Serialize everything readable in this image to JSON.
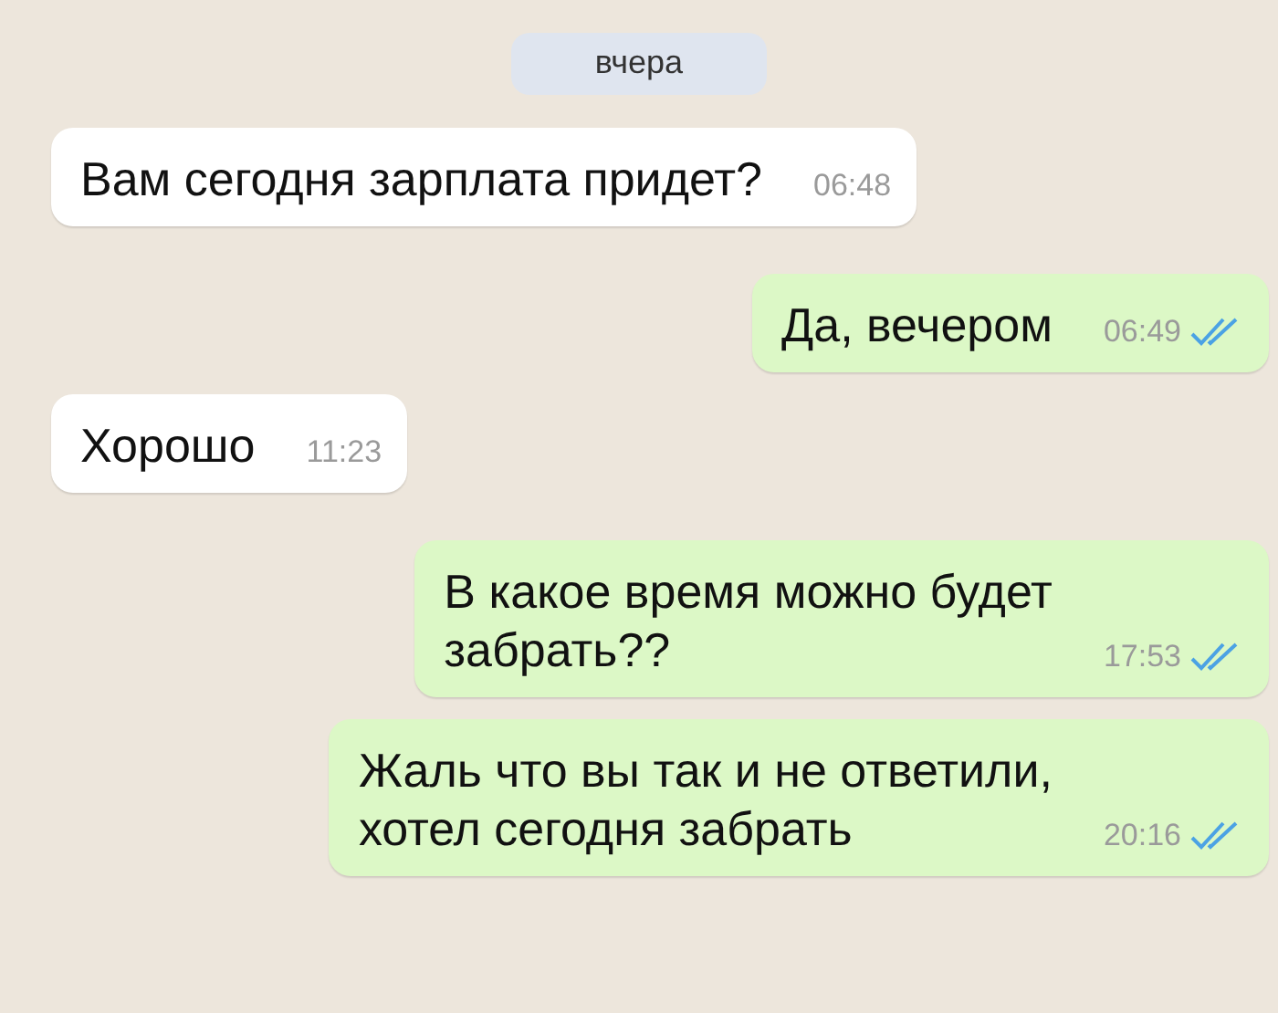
{
  "date_label": "вчера",
  "messages": [
    {
      "kind": "incoming",
      "text": "Вам сегодня зарплата придет?",
      "time": "06:48"
    },
    {
      "kind": "outgoing",
      "text": "Да, вечером",
      "time": "06:49",
      "read": true
    },
    {
      "kind": "incoming",
      "text": "Хорошо",
      "time": "11:23"
    },
    {
      "kind": "outgoing",
      "text": "В какое время можно будет\nзабрать??",
      "time": "17:53",
      "read": true
    },
    {
      "kind": "outgoing",
      "text": "Жаль что вы так и не ответили,\nхотел сегодня забрать",
      "time": "20:16",
      "read": true
    }
  ]
}
